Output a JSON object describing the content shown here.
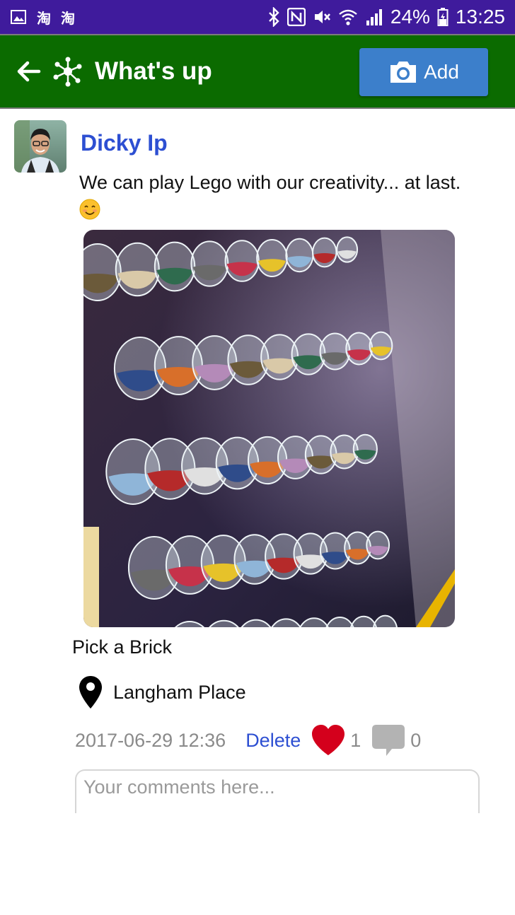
{
  "status_bar": {
    "left_icons": [
      "image-icon",
      "taobao-icon",
      "taobao-icon"
    ],
    "taobao_glyph": "淘",
    "battery": "24%",
    "time": "13:25"
  },
  "app_bar": {
    "title": "What's up",
    "add_label": "Add",
    "background": "#0b6b00",
    "button_color": "#3c7fcb"
  },
  "post": {
    "author": "Dicky Ip",
    "text": "We can play Lego with our creativity... at last.",
    "photo_caption": "Pick a Brick",
    "location": "Langham Place",
    "timestamp": "2017-06-29 12:36",
    "delete_label": "Delete",
    "likes": "1",
    "comments": "0",
    "author_color": "#2d4fd2",
    "like_color": "#d4001c"
  },
  "comment_box": {
    "placeholder": "Your comments here..."
  }
}
